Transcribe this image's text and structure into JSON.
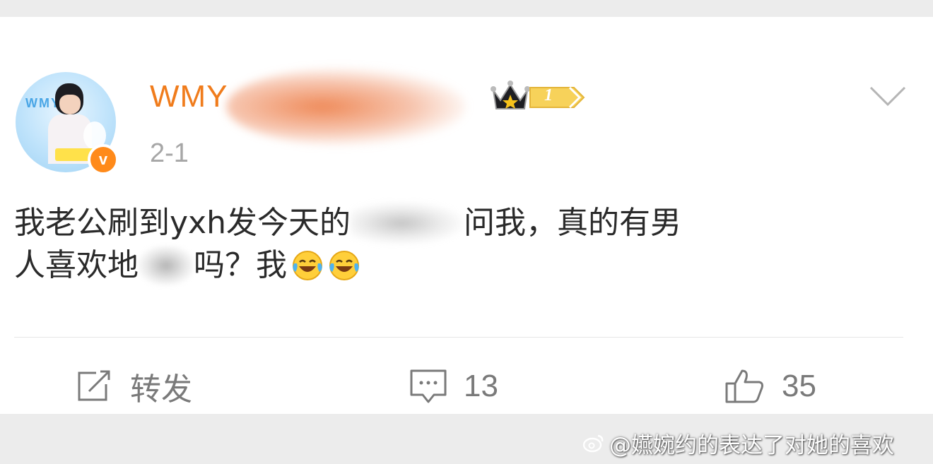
{
  "post": {
    "username_visible": "WMY",
    "level": "1",
    "time": "2-1",
    "verified_badge": "v",
    "content": {
      "line1_before": "我老公刷到yxh发今天的",
      "line1_after": "问我，真的有男",
      "line2_before": "人喜欢",
      "line2_partial": "地",
      "line2_after": "吗？我"
    },
    "emoji": "laugh-cry-emoji"
  },
  "actions": {
    "repost_label": "转发",
    "comment_count": "13",
    "like_count": "35"
  },
  "watermark": {
    "text": "@嬿婉约的表达了对她的喜欢"
  },
  "colors": {
    "username": "#f07c1c",
    "badge": "#ff8a1a",
    "text": "#2a2a2a",
    "muted": "#a6a6a6",
    "background": "#ececec"
  }
}
